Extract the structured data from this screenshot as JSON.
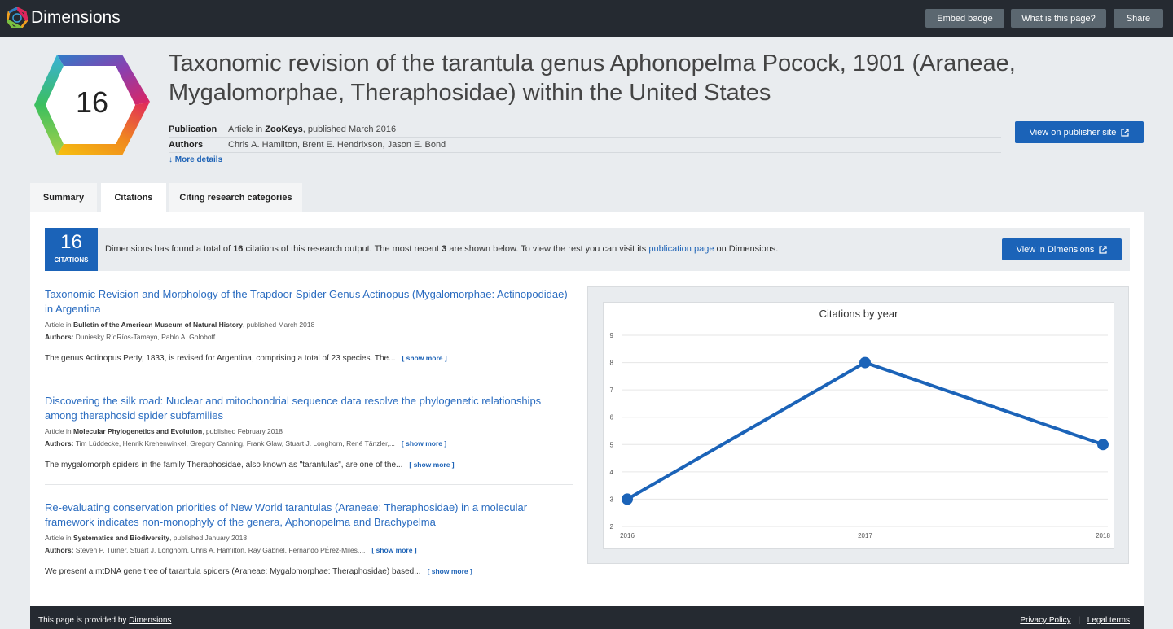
{
  "brand": {
    "name": "Dimensions"
  },
  "topbar": {
    "embed_badge": "Embed badge",
    "what_is": "What is this page?",
    "share": "Share"
  },
  "badge": {
    "count": "16"
  },
  "publication": {
    "title": "Taxonomic revision of the tarantula genus Aphonopelma Pocock, 1901 (Araneae, Mygalomorphae, Theraphosidae) within the United States",
    "publication_label": "Publication",
    "publication_prefix": "Article in ",
    "journal": "ZooKeys",
    "publication_suffix": ", published March 2016",
    "authors_label": "Authors",
    "authors": "Chris A. Hamilton, Brent E. Hendrixson, Jason E. Bond",
    "more_details": "More details",
    "view_publisher": "View on publisher site"
  },
  "tabs": [
    {
      "label": "Summary"
    },
    {
      "label": "Citations"
    },
    {
      "label": "Citing research categories"
    }
  ],
  "citations_info": {
    "count": "16",
    "count_label": "CITATIONS",
    "text_1": "Dimensions has found a total of ",
    "total": "16",
    "text_2": " citations of this research output. The most recent ",
    "recent": "3",
    "text_3": " are shown below. To view the rest you can visit its ",
    "link": "publication page",
    "text_4": " on Dimensions.",
    "view_button": "View in Dimensions"
  },
  "citations": [
    {
      "title": "Taxonomic Revision and Morphology of the Trapdoor Spider Genus Actinopus (Mygalomorphae: Actinopodidae) in Argentina",
      "meta_prefix": "Article in ",
      "journal": "Bulletin of the American Museum of Natural History",
      "meta_suffix": ", published March 2018",
      "authors_label": "Authors: ",
      "authors": "Duniesky RíoRíos-Tamayo, Pablo A. Goloboff",
      "abstract": "The genus Actinopus Perty, 1833, is revised for Argentina, comprising a total of 23 species. The...",
      "show_more": "[ show more ]"
    },
    {
      "title": "Discovering the silk road: Nuclear and mitochondrial sequence data resolve the phylogenetic relationships among theraphosid spider subfamilies",
      "meta_prefix": "Article in ",
      "journal": "Molecular Phylogenetics and Evolution",
      "meta_suffix": ", published February 2018",
      "authors_label": "Authors: ",
      "authors": "Tim Lüddecke, Henrik Krehenwinkel, Gregory Canning, Frank Glaw, Stuart J. Longhorn, René Tänzler,...",
      "abstract": "The mygalomorph spiders in the family Theraphosidae, also known as \"tarantulas\", are one of the...",
      "show_more": "[ show more ]"
    },
    {
      "title": "Re-evaluating conservation priorities of New World tarantulas (Araneae: Theraphosidae) in a molecular framework indicates non-monophyly of the genera, Aphonopelma and Brachypelma",
      "meta_prefix": "Article in ",
      "journal": "Systematics and Biodiversity",
      "meta_suffix": ", published January 2018",
      "authors_label": "Authors: ",
      "authors": "Steven P. Turner, Stuart J. Longhorn, Chris A. Hamilton, Ray Gabriel, Fernando PÉrez-Miles,...",
      "abstract": "We present a mtDNA gene tree of tarantula spiders (Araneae: Mygalomorphae: Theraphosidae) based...",
      "show_more": "[ show more ]"
    }
  ],
  "chart_data": {
    "type": "line",
    "title": "Citations by year",
    "x": [
      "2016",
      "2017",
      "2018"
    ],
    "values": [
      3,
      8,
      5
    ],
    "ylim": [
      2,
      9
    ],
    "yticks": [
      "2",
      "3",
      "4",
      "5",
      "6",
      "7",
      "8",
      "9"
    ],
    "grid": true,
    "color": "#1b63b8"
  },
  "footer": {
    "provided_by": "This page is provided by ",
    "provider_link": "Dimensions",
    "privacy": "Privacy Policy",
    "separator": "|",
    "legal": "Legal terms"
  }
}
